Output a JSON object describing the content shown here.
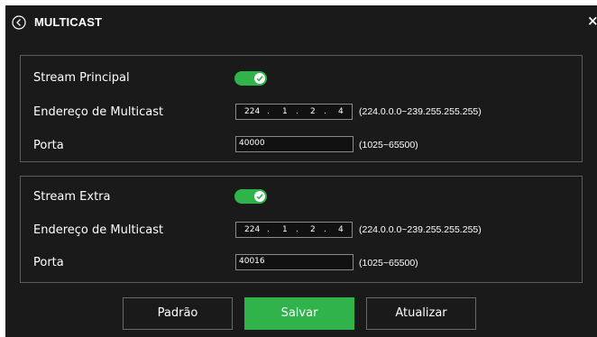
{
  "dialog": {
    "title": "MULTICAST",
    "back_icon": "back-circle-icon",
    "close_icon": "close-icon",
    "close_glyph": "×"
  },
  "colors": {
    "background": "#1a1a1a",
    "accent": "#2fb34a",
    "border": "#5b5b5b",
    "text": "#ffffff"
  },
  "main_stream": {
    "toggle_label": "Stream Principal",
    "enabled": true,
    "address_label": "Endereço de Multicast",
    "address": [
      "224",
      "1",
      "2",
      "4"
    ],
    "address_range": "(224.0.0.0~239.255.255.255)",
    "port_label": "Porta",
    "port": "40000",
    "port_range": "(1025~65500)"
  },
  "extra_stream": {
    "toggle_label": "Stream Extra",
    "enabled": true,
    "address_label": "Endereço de Multicast",
    "address": [
      "224",
      "1",
      "2",
      "4"
    ],
    "address_range": "(224.0.0.0~239.255.255.255)",
    "port_label": "Porta",
    "port": "40016",
    "port_range": "(1025~65500)"
  },
  "ip_separator": ".",
  "buttons": {
    "default": "Padrão",
    "save": "Salvar",
    "refresh": "Atualizar"
  }
}
